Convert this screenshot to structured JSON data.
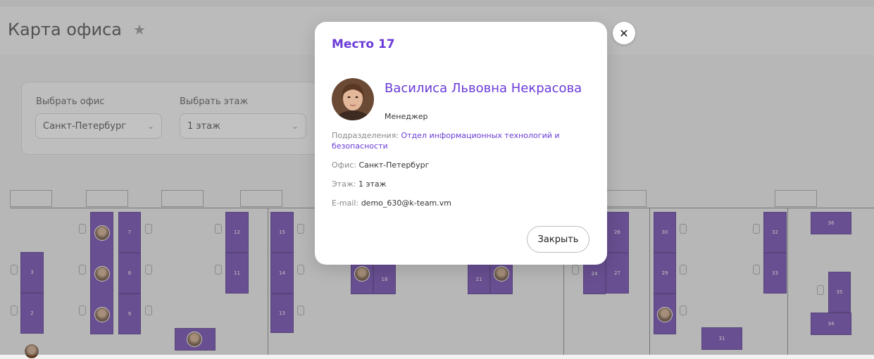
{
  "header": {
    "title": "Карта офиса",
    "favorite_icon": "star-icon"
  },
  "filters": {
    "office_label": "Выбрать офис",
    "office_value": "Санкт-Петербург",
    "floor_label": "Выбрать этаж",
    "floor_value": "1 этаж"
  },
  "map": {
    "desk_numbers": [
      "3",
      "2",
      "7",
      "8",
      "9",
      "12",
      "11",
      "15",
      "14",
      "13",
      "18",
      "21",
      "24",
      "26",
      "27",
      "30",
      "29",
      "32",
      "33",
      "36",
      "35",
      "34",
      "31"
    ]
  },
  "modal": {
    "title": "Место 17",
    "employee_name": "Василиса Львовна Некрасова",
    "employee_role": "Менеджер",
    "department_label": "Подразделения:",
    "department_value": "Отдел информационных технологий и безопасности",
    "office_label": "Офис:",
    "office_value": "Санкт-Петербург",
    "floor_label": "Этаж:",
    "floor_value": "1 этаж",
    "email_label": "E-mail:",
    "email_value": "demo_630@k-team.vm",
    "close_label": "Закрыть"
  },
  "colors": {
    "accent": "#6a3bd7",
    "desk": "#5b2ea6"
  }
}
